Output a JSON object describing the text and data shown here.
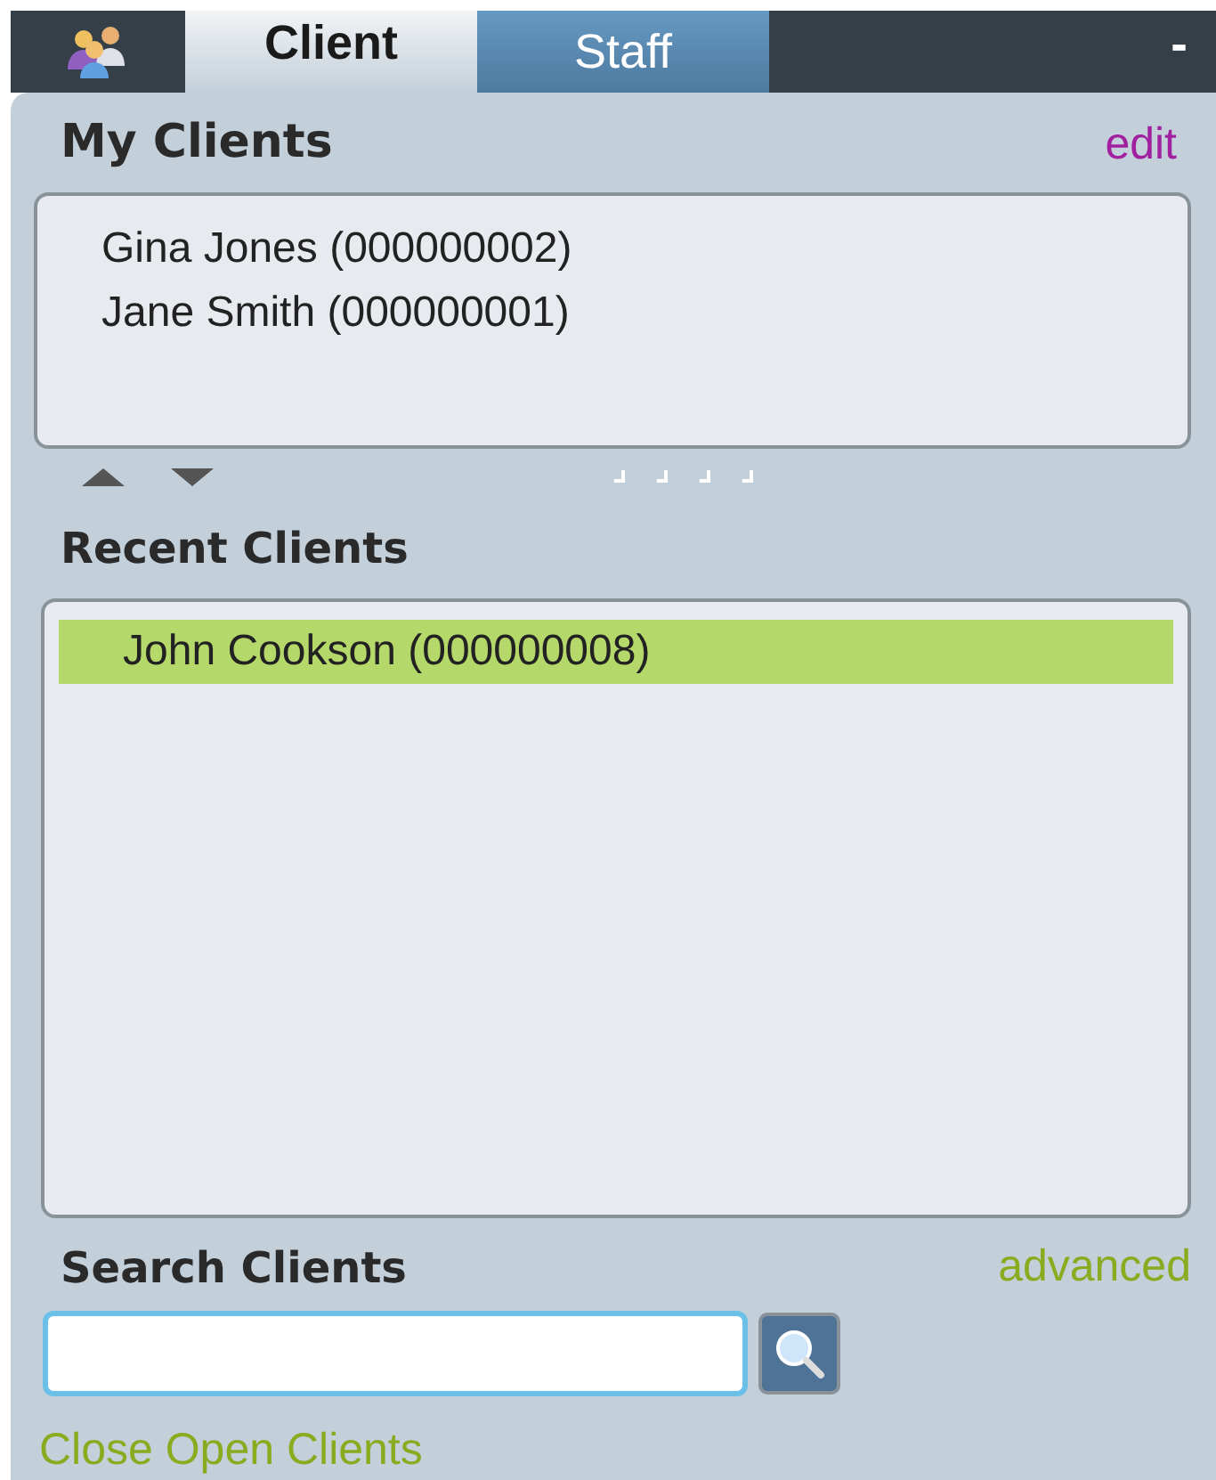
{
  "tabs": [
    {
      "label": "Client",
      "selected": true
    },
    {
      "label": "Staff",
      "selected": false
    }
  ],
  "minimize": "-",
  "my_clients": {
    "title": "My Clients",
    "edit_link": "edit",
    "items": [
      {
        "label": "Gina Jones (000000002)",
        "selected": false
      },
      {
        "label": "Jane Smith (000000001)",
        "selected": false
      }
    ]
  },
  "recent_clients": {
    "title": "Recent Clients",
    "items": [
      {
        "label": "John Cookson (000000008)",
        "selected": true
      }
    ]
  },
  "search": {
    "title": "Search Clients",
    "advanced_link": "advanced"
  },
  "close_link": "Close Open Clients"
}
